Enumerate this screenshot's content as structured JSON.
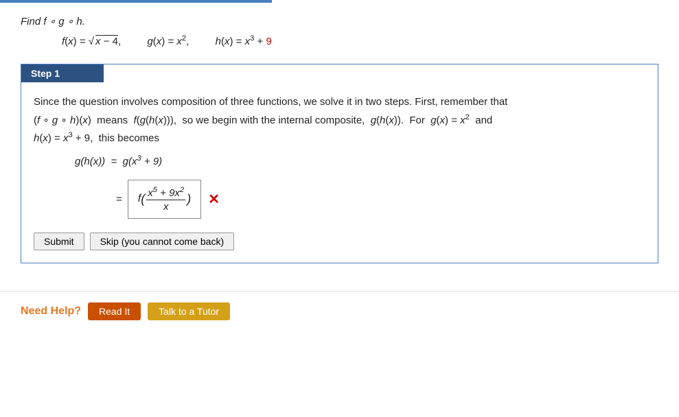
{
  "topbar": {},
  "problem": {
    "instruction": "Find f ∘ g ∘ h.",
    "f_label": "f(x) =",
    "f_value": "√(x − 4),",
    "g_label": "g(x) = x²,",
    "h_label": "h(x) = x³ +",
    "h_red": "9"
  },
  "step1": {
    "header": "Step 1",
    "text1": "Since the question involves composition of three functions, we solve it in two steps. First, remember that",
    "text2": "(f ∘ g ∘ h)(x)  means  f(g(h(x))),  so we begin with the internal composite,  g(h(x)).  For  g(x) = x²  and",
    "text3": "h(x) = x³ + 9,  this becomes",
    "math_line1": "g(h(x))  =  g(x³ + 9)",
    "equals_sign": "=",
    "fraction_numerator": "x⁵ + 9x²",
    "fraction_denominator": "x",
    "func_prefix": "f"
  },
  "buttons": {
    "submit": "Submit",
    "skip": "Skip (you cannot come back)"
  },
  "need_help": {
    "label": "Need Help?",
    "read_it": "Read It",
    "talk_to_tutor": "Talk to a Tutor"
  }
}
